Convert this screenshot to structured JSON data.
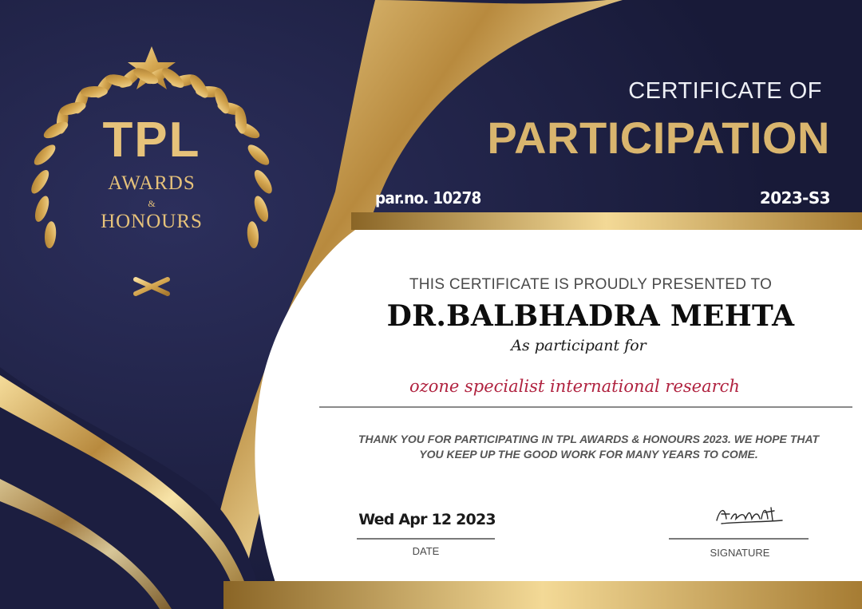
{
  "certificate": {
    "heading_top": "CERTIFICATE OF",
    "heading_main": "PARTICIPATION",
    "par_no": "par.no. 10278",
    "code": "2023-S3",
    "presented_line": "THIS CERTIFICATE IS PROUDLY PRESENTED TO",
    "recipient": "DR.BALBHADRA MEHTA",
    "as_participant": "As participant for",
    "category": "ozone specialist international research",
    "thanks_line1": "THANK YOU FOR PARTICIPATING IN TPL AWARDS & HONOURS 2023. WE HOPE THAT",
    "thanks_line2": "YOU KEEP UP THE GOOD WORK FOR MANY YEARS TO COME.",
    "date_value": "Wed Apr 12 2023",
    "date_label": "DATE",
    "signature_label": "SIGNATURE"
  },
  "emblem": {
    "line1": "TPL",
    "line2": "AWARDS",
    "line3": "&",
    "line4": "HONOURS",
    "icons": [
      "star-icon",
      "laurel-wreath-icon"
    ]
  },
  "colors": {
    "navy": "#22244a",
    "gold": "#d9b56e",
    "gold_dark": "#9a7430",
    "category_red": "#b0223f"
  }
}
